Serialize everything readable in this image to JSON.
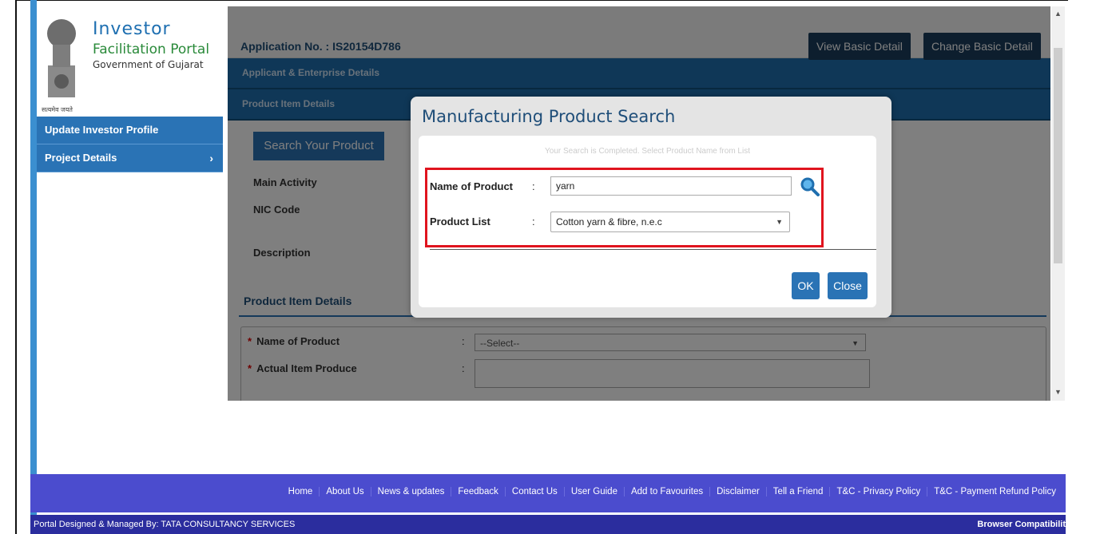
{
  "logo": {
    "line1": "Investor",
    "line2": "Facilitation Portal",
    "line3": "Government of Gujarat",
    "motto": "सत्यमेव जयते"
  },
  "sidebar": {
    "items": [
      {
        "label": "Update Investor Profile"
      },
      {
        "label": "Project Details",
        "chevron": "›"
      }
    ]
  },
  "header": {
    "application_no": "Application No. : IS20154D786",
    "view_basic_detail": "View Basic Detail",
    "change_basic_detail": "Change Basic Detail"
  },
  "sections": {
    "applicant": "Applicant & Enterprise Details",
    "product_item": "Product Item Details"
  },
  "content": {
    "search_button": "Search Your Product",
    "main_activity": "Main Activity",
    "nic_code": "NIC Code",
    "description": "Description",
    "product_item_heading": "Product Item Details",
    "form": {
      "name_of_product_label": "Name of Product",
      "name_of_product_value": "--Select--",
      "actual_item_label": "Actual Item Produce",
      "colon": ":",
      "required_mark": "*"
    }
  },
  "modal": {
    "title": "Manufacturing Product Search",
    "info": "Your Search is Completed. Select Product Name from List",
    "name_label": "Name of Product",
    "name_value": "yarn",
    "list_label": "Product List",
    "list_value": "Cotton yarn & fibre, n.e.c",
    "colon": ":",
    "ok": "OK",
    "close": "Close"
  },
  "footer": {
    "links": [
      "Home",
      "About Us",
      "News & updates",
      "Feedback",
      "Contact Us",
      "User Guide",
      "Add to Favourites",
      "Disclaimer",
      "Tell a Friend",
      "T&C - Privacy Policy",
      "T&C - Payment Refund Policy"
    ],
    "designed_by": "Portal Designed & Managed By: TATA CONSULTANCY SERVICES",
    "browser": "Browser Compatibilit"
  },
  "icons": {
    "search": "magnifier-icon",
    "dropdown": "▼"
  },
  "colors": {
    "primary": "#2a73b5",
    "highlight": "#e0141e",
    "footer": "#4b4cce"
  }
}
